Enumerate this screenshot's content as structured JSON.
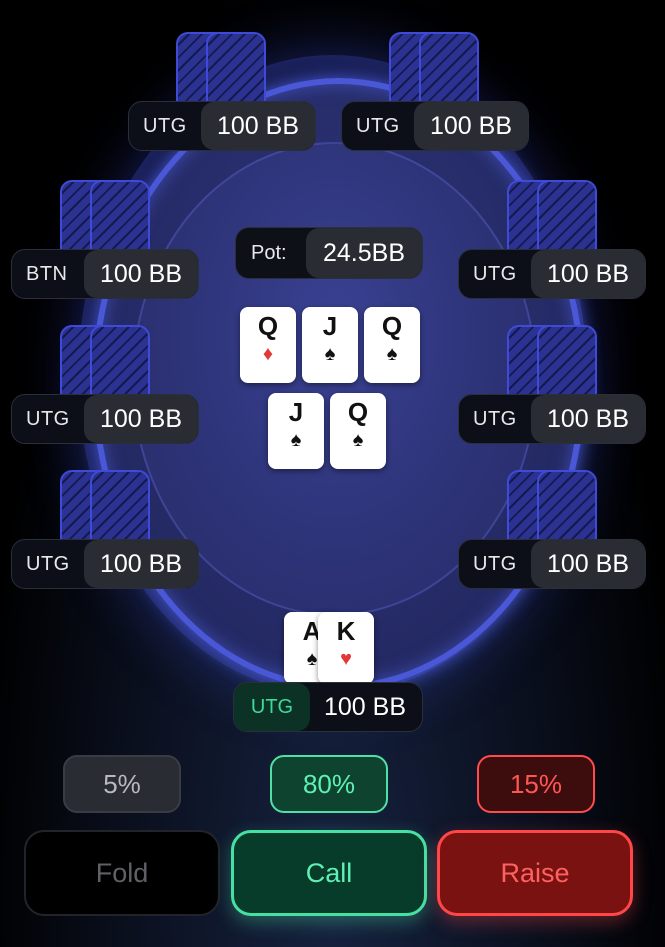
{
  "table": {
    "pot_label": "Pot:",
    "pot_value": "24.5BB"
  },
  "seats": [
    {
      "position": "UTG",
      "stack": "100 BB"
    },
    {
      "position": "UTG",
      "stack": "100 BB"
    },
    {
      "position": "BTN",
      "stack": "100 BB"
    },
    {
      "position": "UTG",
      "stack": "100 BB"
    },
    {
      "position": "UTG",
      "stack": "100 BB"
    },
    {
      "position": "UTG",
      "stack": "100 BB"
    },
    {
      "position": "UTG",
      "stack": "100 BB"
    },
    {
      "position": "UTG",
      "stack": "100 BB"
    }
  ],
  "board": [
    {
      "rank": "Q",
      "suit": "♦",
      "color": "#e33838"
    },
    {
      "rank": "J",
      "suit": "♠",
      "color": "#111111"
    },
    {
      "rank": "Q",
      "suit": "♠",
      "color": "#111111"
    },
    {
      "rank": "J",
      "suit": "♠",
      "color": "#111111"
    },
    {
      "rank": "Q",
      "suit": "♠",
      "color": "#111111"
    }
  ],
  "hero": {
    "position": "UTG",
    "stack": "100 BB",
    "cards": [
      {
        "rank": "A",
        "suit": "♠",
        "color": "#111111"
      },
      {
        "rank": "K",
        "suit": "♥",
        "color": "#e33838"
      }
    ]
  },
  "frequencies": {
    "fold": "5%",
    "call": "80%",
    "raise": "15%"
  },
  "actions": {
    "fold": "Fold",
    "call": "Call",
    "raise": "Raise"
  },
  "colors": {
    "table_rail": "#4a58d8",
    "call_accent": "#48e0a2",
    "raise_accent": "#ff4747",
    "background": "#000000"
  }
}
